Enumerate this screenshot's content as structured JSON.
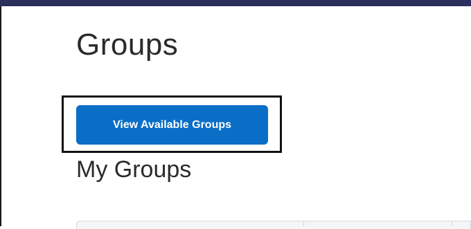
{
  "page": {
    "title": "Groups",
    "section_title": "My Groups"
  },
  "actions": {
    "view_available_groups_label": "View Available Groups"
  },
  "colors": {
    "top_bar": "#2b2f5e",
    "primary_button": "#0a6ec7",
    "highlight_border": "#111111"
  }
}
